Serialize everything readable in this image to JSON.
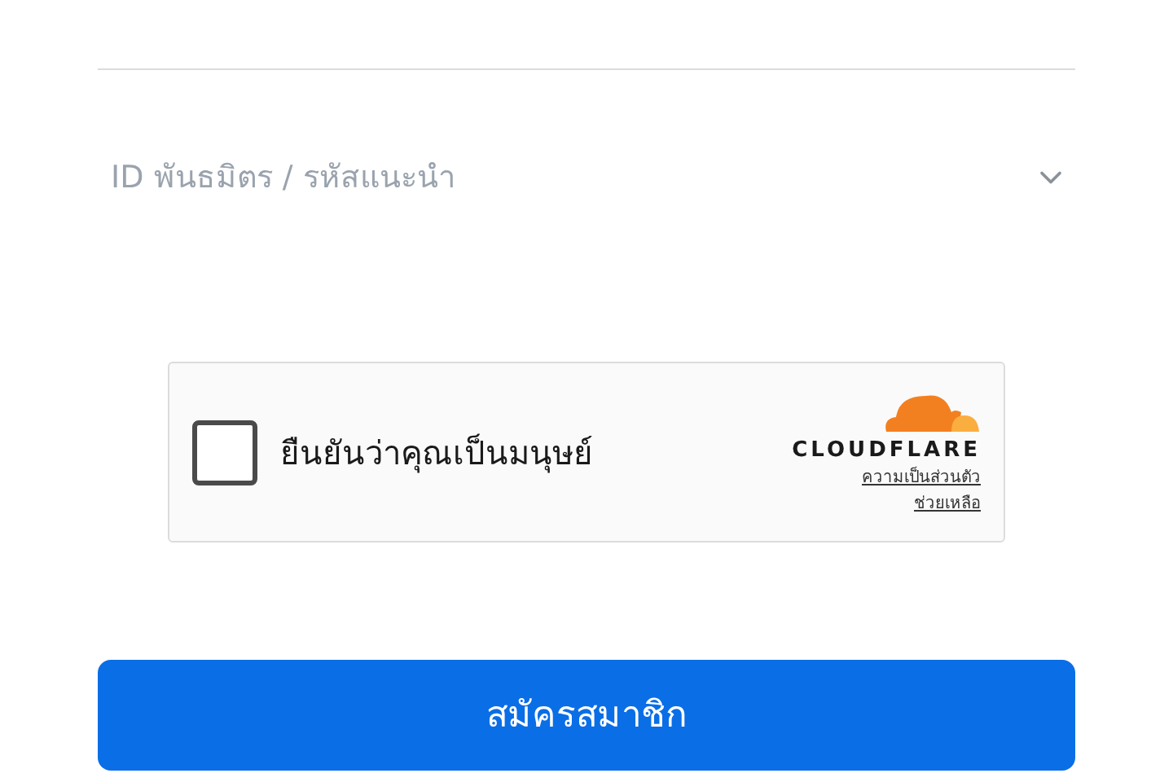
{
  "referral": {
    "label": "ID พันธมิตร / รหัสแนะนำ",
    "expanded": false
  },
  "captcha": {
    "label": "ยืนยันว่าคุณเป็นมนุษย์",
    "checked": false,
    "brand": "CLOUDFLARE",
    "links": [
      "ความเป็นส่วนตัว",
      "ช่วยเหลือ"
    ]
  },
  "submit": {
    "label": "สมัครสมาชิก"
  }
}
